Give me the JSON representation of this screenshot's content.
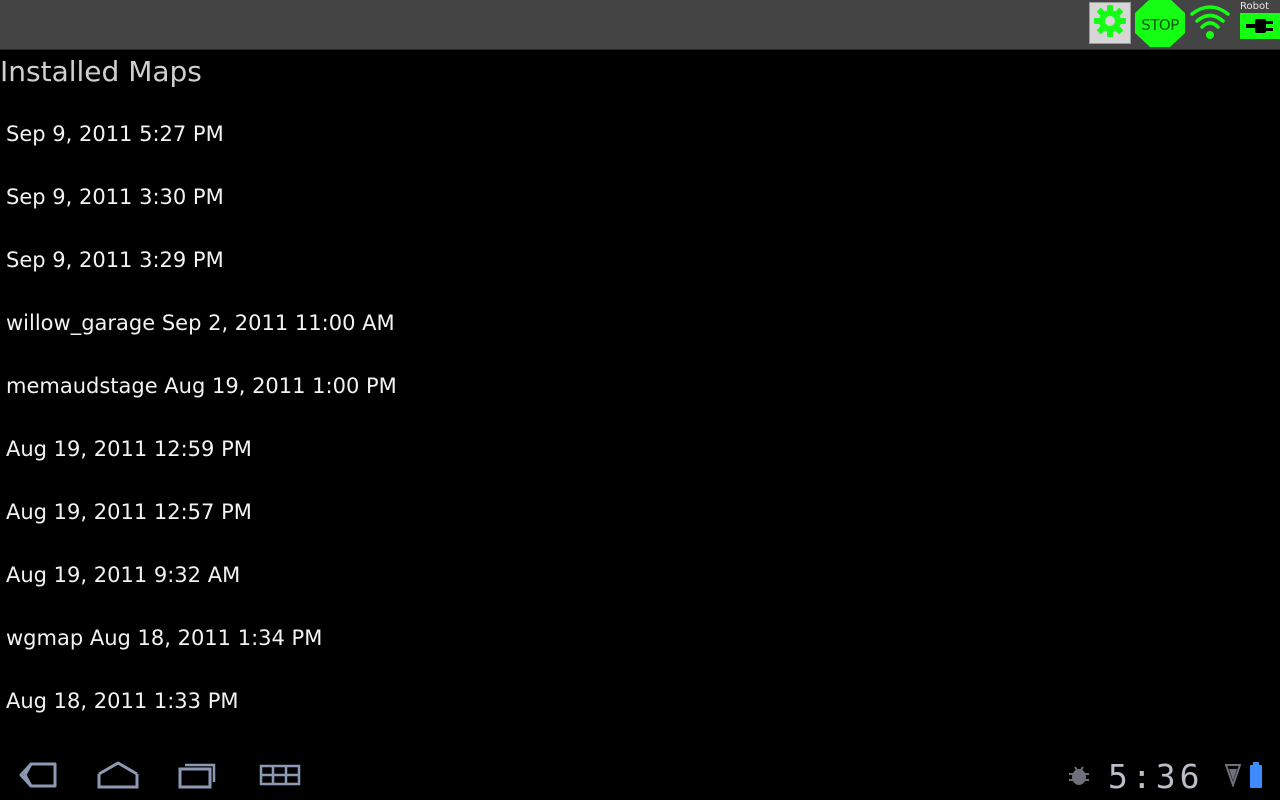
{
  "statusbar": {
    "stop_label": "STOP",
    "robot_label": "Robot",
    "icons": {
      "settings": "gear-icon",
      "stop": "stop-sign-icon",
      "wifi": "wifi-icon",
      "robot_battery": "battery-plug-icon"
    },
    "accent_color": "#14ff14"
  },
  "page": {
    "title": "Installed Maps"
  },
  "maps": [
    {
      "label": "Sep 9, 2011 5:27 PM"
    },
    {
      "label": "Sep 9, 2011 3:30 PM"
    },
    {
      "label": "Sep 9, 2011 3:29 PM"
    },
    {
      "label": "willow_garage Sep 2, 2011 11:00 AM"
    },
    {
      "label": "memaudstage Aug 19, 2011 1:00 PM"
    },
    {
      "label": "Aug 19, 2011 12:59 PM"
    },
    {
      "label": "Aug 19, 2011 12:57 PM"
    },
    {
      "label": "Aug 19, 2011 9:32 AM"
    },
    {
      "label": "wgmap Aug 18, 2011 1:34 PM"
    },
    {
      "label": "Aug 18, 2011 1:33 PM"
    }
  ],
  "navbar": {
    "icons": {
      "back": "back-icon",
      "home": "home-icon",
      "recents": "recent-apps-icon",
      "menu": "menu-grid-icon",
      "debug": "android-debug-icon",
      "signal": "signal-icon",
      "battery": "battery-icon"
    },
    "clock": "5:36"
  }
}
